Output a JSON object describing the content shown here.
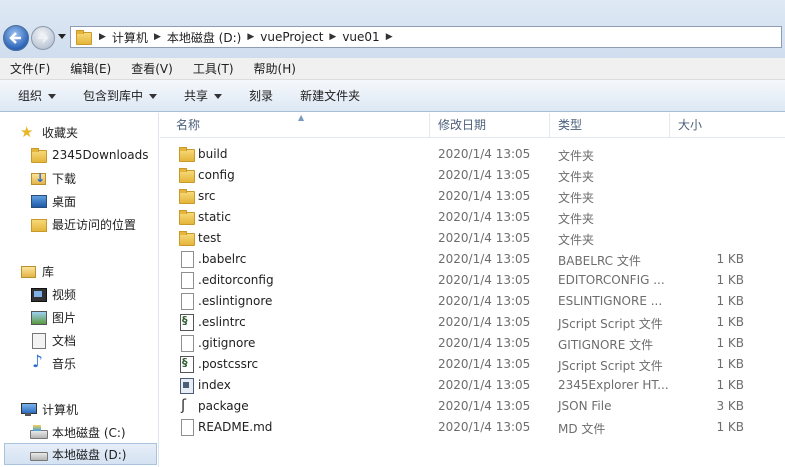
{
  "address": {
    "crumbs": [
      "计算机",
      "本地磁盘 (D:)",
      "vueProject",
      "vue01"
    ]
  },
  "menu": [
    "文件(F)",
    "编辑(E)",
    "查看(V)",
    "工具(T)",
    "帮助(H)"
  ],
  "toolbar": {
    "organize": "组织",
    "include_in_library": "包含到库中",
    "share": "共享",
    "burn": "刻录",
    "new_folder": "新建文件夹"
  },
  "nav": {
    "favorites": "收藏夹",
    "fav_items": [
      "2345Downloads",
      "下载",
      "桌面",
      "最近访问的位置"
    ],
    "libraries": "库",
    "lib_items": [
      "视频",
      "图片",
      "文档",
      "音乐"
    ],
    "computer": "计算机",
    "drives": [
      "本地磁盘 (C:)",
      "本地磁盘 (D:)"
    ]
  },
  "columns": {
    "name": "名称",
    "modified": "修改日期",
    "type": "类型",
    "size": "大小"
  },
  "files": [
    {
      "name": "build",
      "modified": "2020/1/4 13:05",
      "type": "文件夹",
      "size": "",
      "icon": "folder-icon"
    },
    {
      "name": "config",
      "modified": "2020/1/4 13:05",
      "type": "文件夹",
      "size": "",
      "icon": "folder-icon"
    },
    {
      "name": "src",
      "modified": "2020/1/4 13:05",
      "type": "文件夹",
      "size": "",
      "icon": "folder-icon"
    },
    {
      "name": "static",
      "modified": "2020/1/4 13:05",
      "type": "文件夹",
      "size": "",
      "icon": "folder-icon"
    },
    {
      "name": "test",
      "modified": "2020/1/4 13:05",
      "type": "文件夹",
      "size": "",
      "icon": "folder-icon"
    },
    {
      "name": ".babelrc",
      "modified": "2020/1/4 13:05",
      "type": "BABELRC 文件",
      "size": "1 KB",
      "icon": "file-icon"
    },
    {
      "name": ".editorconfig",
      "modified": "2020/1/4 13:05",
      "type": "EDITORCONFIG ...",
      "size": "1 KB",
      "icon": "file-icon"
    },
    {
      "name": ".eslintignore",
      "modified": "2020/1/4 13:05",
      "type": "ESLINTIGNORE ...",
      "size": "1 KB",
      "icon": "file-icon"
    },
    {
      "name": ".eslintrc",
      "modified": "2020/1/4 13:05",
      "type": "JScript Script 文件",
      "size": "1 KB",
      "icon": "script-icon"
    },
    {
      "name": ".gitignore",
      "modified": "2020/1/4 13:05",
      "type": "GITIGNORE 文件",
      "size": "1 KB",
      "icon": "file-icon"
    },
    {
      "name": ".postcssrc",
      "modified": "2020/1/4 13:05",
      "type": "JScript Script 文件",
      "size": "1 KB",
      "icon": "script-icon"
    },
    {
      "name": "index",
      "modified": "2020/1/4 13:05",
      "type": "2345Explorer HT...",
      "size": "1 KB",
      "icon": "html-icon"
    },
    {
      "name": "package",
      "modified": "2020/1/4 13:05",
      "type": "JSON File",
      "size": "3 KB",
      "icon": "json-icon"
    },
    {
      "name": "README.md",
      "modified": "2020/1/4 13:05",
      "type": "MD 文件",
      "size": "1 KB",
      "icon": "file-icon"
    }
  ]
}
